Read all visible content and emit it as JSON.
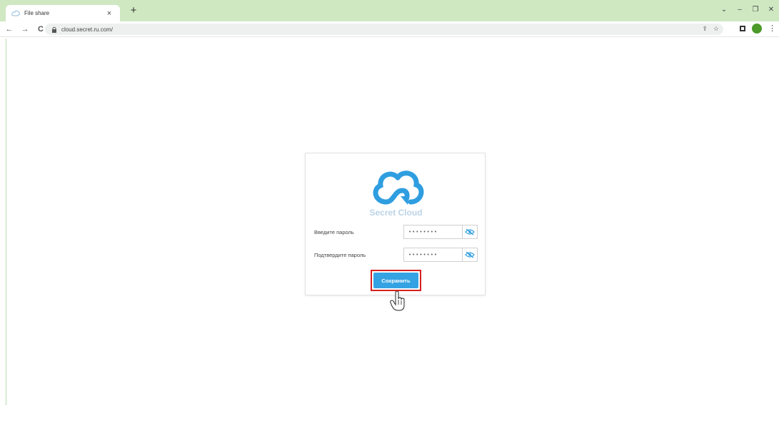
{
  "browser": {
    "tab_title": "File share",
    "tab_close": "×",
    "new_tab": "+",
    "url": "cloud.secret.ru.com/",
    "controls": {
      "collapse": "⌄",
      "minimize": "–",
      "restore": "❐",
      "close": "✕"
    },
    "nav": {
      "back": "←",
      "forward": "→",
      "reload": "C"
    },
    "omnibox_icons": {
      "share": "⇪",
      "bookmark": "☆"
    },
    "menu": "⋮",
    "frame_color": "#cfe8c2",
    "profile_color": "#4c9a2a"
  },
  "card": {
    "brand": "Secret Cloud",
    "password_label": "Введите пароль",
    "confirm_label": "Подтвердите пароль",
    "password_value": "••••••••",
    "confirm_value": "••••••••",
    "eye_icon": "eye-off-icon",
    "save_label": "Сохранить",
    "accent_color": "#35a3e3",
    "highlight_color": "#d62020"
  }
}
